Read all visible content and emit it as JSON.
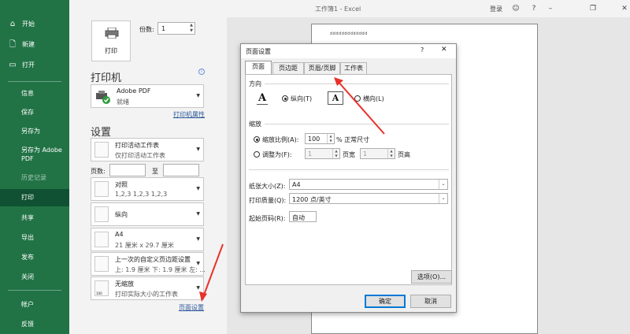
{
  "titlebar": {
    "title": "工作簿1  -  Excel",
    "login": "登录"
  },
  "sidebar": {
    "items": [
      {
        "label": "开始",
        "icon": "home-icon"
      },
      {
        "label": "新建",
        "icon": "new-file-icon"
      },
      {
        "label": "打开",
        "icon": "folder-open-icon"
      },
      {
        "label": "信息"
      },
      {
        "label": "保存"
      },
      {
        "label": "另存为"
      },
      {
        "label": "另存为 Adobe PDF"
      },
      {
        "label": "历史记录"
      },
      {
        "label": "打印"
      },
      {
        "label": "共享"
      },
      {
        "label": "导出"
      },
      {
        "label": "发布"
      },
      {
        "label": "关闭"
      },
      {
        "label": "帐户"
      },
      {
        "label": "反馈"
      }
    ]
  },
  "print": {
    "button_label": "打印",
    "copies_label": "份数:",
    "copies_value": "1",
    "printer_heading": "打印机",
    "printer_name": "Adobe PDF",
    "printer_status": "就绪",
    "printer_props_link": "打印机属性",
    "settings_heading": "设置",
    "print_what": {
      "l1": "打印活动工作表",
      "l2": "仅打印活动工作表"
    },
    "pages_label": "页数:",
    "pages_to": "至",
    "collate": {
      "l1": "对照",
      "l2": "1,2,3    1,2,3    1,2,3"
    },
    "orientation": {
      "l1": "纵向"
    },
    "paper": {
      "l1": "A4",
      "l2": "21 厘米 x 29.7 厘米"
    },
    "margins": {
      "l1": "上一次的自定义页边距设置",
      "l2": "上: 1.9 厘米 下: 1.9 厘米 左: ..."
    },
    "scaling": {
      "l1": "无缩放",
      "l2": "打印实际大小的工作表"
    },
    "page_setup_link": "页面设置"
  },
  "preview": {
    "header_text": "ddddddddddddd"
  },
  "dialog": {
    "title": "页面设置",
    "help": "?",
    "tabs": [
      "页面",
      "页边距",
      "页眉/页脚",
      "工作表"
    ],
    "orientation_group": "方向",
    "portrait_label": "纵向(T)",
    "landscape_label": "横向(L)",
    "scaling_group": "缩放",
    "adjust_label": "缩放比例(A):",
    "adjust_value": "100",
    "adjust_unit": "% 正常尺寸",
    "fit_label": "调整为(F):",
    "fit_wide_value": "1",
    "fit_wide_unit": "页宽",
    "fit_tall_value": "1",
    "fit_tall_unit": "页高",
    "paper_size_label": "纸张大小(Z):",
    "paper_size_value": "A4",
    "print_quality_label": "打印质量(Q):",
    "print_quality_value": "1200 点/英寸",
    "first_page_label": "起始页码(R):",
    "first_page_value": "自动",
    "options_button": "选项(O)...",
    "ok_button": "确定",
    "cancel_button": "取消"
  },
  "colors": {
    "sidebar": "#217346",
    "sidebar_active": "#0f5132",
    "accent_arrow": "#e8312b",
    "link": "#2b579a"
  }
}
